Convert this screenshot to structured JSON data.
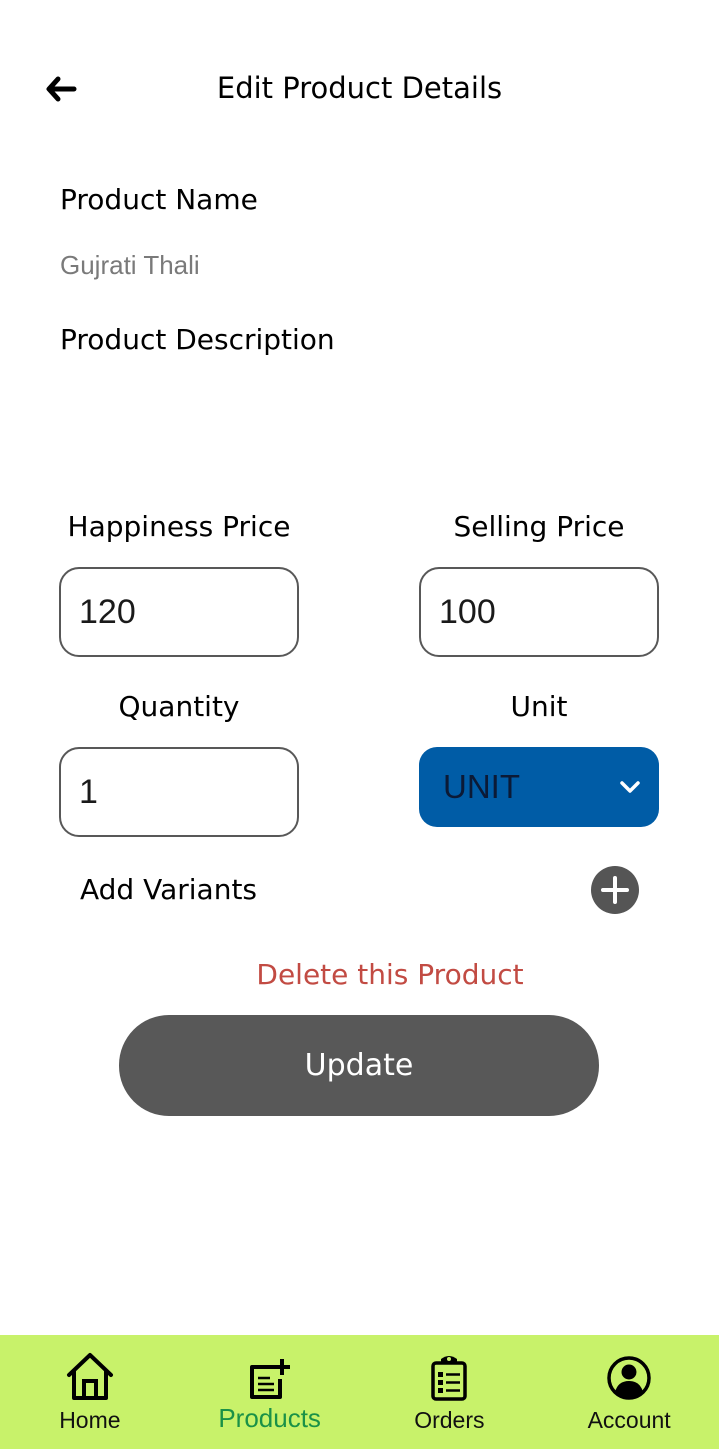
{
  "header": {
    "title": "Edit Product Details",
    "back_icon": "arrow-left-icon"
  },
  "form": {
    "product_name": {
      "label": "Product Name",
      "value": "Gujrati Thali"
    },
    "product_description": {
      "label": "Product Description",
      "value": ""
    },
    "happiness_price": {
      "label": "Happiness Price",
      "value": "120"
    },
    "selling_price": {
      "label": "Selling Price",
      "value": "100"
    },
    "quantity": {
      "label": "Quantity",
      "value": "1"
    },
    "unit": {
      "label": "Unit",
      "selected": "UNIT",
      "icon": "chevron-down-icon"
    },
    "variants": {
      "label": "Add Variants",
      "icon": "plus-circle-icon"
    },
    "delete_label": "Delete this Product",
    "update_label": "Update"
  },
  "colors": {
    "nav_background": "#c8f26a",
    "nav_active": "#1a9147",
    "unit_select_bg": "#005ca6",
    "delete_text": "#c24b43",
    "update_button_bg": "#585858"
  },
  "bottom_nav": {
    "active": "Products",
    "items": [
      {
        "label": "Home",
        "icon": "home-icon"
      },
      {
        "label": "Products",
        "icon": "add-note-icon"
      },
      {
        "label": "Orders",
        "icon": "clipboard-list-icon"
      },
      {
        "label": "Account",
        "icon": "account-circle-icon"
      }
    ]
  }
}
